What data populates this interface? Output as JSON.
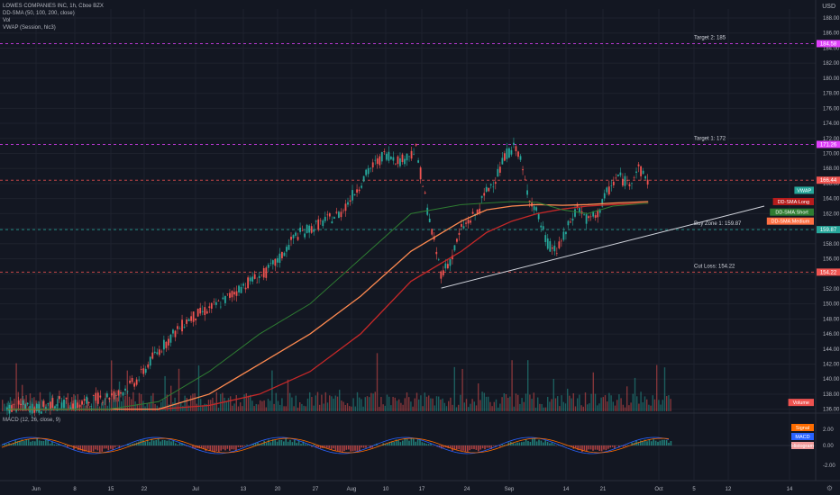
{
  "legend": {
    "title": "LOWES COMPANIES INC, 1h, Cboe BZX",
    "ind1": "DD-SMA (50, 100, 200, close)",
    "ind2": "Vol",
    "ind3": "VWAP (Session, hlc3)"
  },
  "currency": "USD",
  "chart_data": {
    "type": "candlestick",
    "x_ticks": [
      "Jun",
      "8",
      "15",
      "22",
      "Jul",
      "13",
      "20",
      "27",
      "Aug",
      "10",
      "17",
      "24",
      "Sep",
      "14",
      "21",
      "Oct",
      "5",
      "12",
      "14"
    ],
    "y_ticks": [
      136,
      138,
      140,
      142,
      144,
      146,
      148,
      150,
      152,
      154,
      156,
      158,
      160,
      162,
      164,
      166,
      168,
      170,
      172,
      174,
      176,
      178,
      180,
      182,
      184,
      186,
      188
    ],
    "ylim": [
      135.6,
      189.2
    ],
    "levels": [
      {
        "name": "target2",
        "label": "Target 2: 185",
        "price": 184.6,
        "tag": "184.58",
        "color": "#e040fb"
      },
      {
        "name": "target1",
        "label": "Target 1: 172",
        "price": 171.2,
        "tag": "171.26",
        "color": "#e040fb"
      },
      {
        "name": "current",
        "label": "",
        "price": 166.44,
        "tag": "166.44",
        "color": "#ef5350"
      },
      {
        "name": "buyzone",
        "label": "Buy Zone 1: 159.87",
        "price": 159.87,
        "tag": "159.87",
        "color": "#26a69a"
      },
      {
        "name": "cutloss",
        "label": "Cut Loss: 154.22",
        "price": 154.22,
        "tag": "154.22",
        "color": "#ef5350"
      }
    ],
    "side_tags": [
      {
        "label": "VWAP",
        "price": 165.1,
        "color": "#26a69a"
      },
      {
        "label": "DD-SMA:Long",
        "price": 163.6,
        "color": "#b71c1c"
      },
      {
        "label": "DD-SMA:Short",
        "price": 162.2,
        "color": "#2e7d32"
      },
      {
        "label": "DD-SMA:Medium",
        "price": 161.0,
        "color": "#ff7043"
      },
      {
        "label": "Volume",
        "price": 136.9,
        "color": "#ef5350"
      }
    ],
    "price_path": {
      "days": [
        0,
        3,
        6,
        10,
        14,
        18,
        22,
        26,
        29,
        33,
        36,
        39,
        42,
        45,
        48,
        51,
        54,
        57,
        60,
        63,
        66,
        69,
        72,
        75,
        78,
        81,
        84,
        86,
        88,
        90,
        93,
        95,
        97,
        99,
        101,
        103,
        105,
        107,
        109,
        111,
        113,
        115,
        117,
        119,
        121,
        123,
        125,
        127
      ],
      "close": [
        136,
        136.5,
        136,
        137,
        136.5,
        137.5,
        138,
        140,
        143,
        146,
        148,
        149,
        150,
        151.5,
        153,
        154,
        156,
        159,
        160,
        161,
        162,
        165,
        168,
        170,
        169,
        170.5,
        160,
        154,
        156,
        160,
        162,
        165,
        167,
        170,
        171,
        165,
        162,
        158,
        157,
        160,
        163,
        161,
        162,
        165,
        167,
        166,
        168,
        166.4
      ]
    },
    "sma50": {
      "days": [
        0,
        20,
        30,
        40,
        50,
        60,
        70,
        80,
        90,
        95,
        100,
        105,
        110,
        115,
        120,
        127
      ],
      "values": [
        136,
        136,
        137,
        141,
        146,
        150,
        156,
        162,
        163.2,
        163.4,
        163.6,
        163.5,
        162.5,
        162,
        163,
        163.4
      ]
    },
    "sma100": {
      "days": [
        0,
        20,
        30,
        40,
        50,
        60,
        70,
        80,
        90,
        95,
        100,
        105,
        110,
        115,
        120,
        127
      ],
      "values": [
        136,
        136,
        136,
        138,
        142,
        146,
        151,
        157,
        161,
        162.5,
        163,
        163.2,
        163.1,
        163.2,
        163.4,
        163.6
      ]
    },
    "sma200": {
      "days": [
        0,
        20,
        30,
        40,
        50,
        60,
        70,
        80,
        90,
        95,
        100,
        105,
        110,
        115,
        120,
        127
      ],
      "values": [
        136,
        136,
        136,
        136.5,
        138,
        141,
        146,
        153,
        157,
        159.5,
        161,
        162,
        162.6,
        163,
        163.2,
        163.4
      ]
    },
    "trendline": {
      "from": {
        "day": 86,
        "price": 152.1
      },
      "to": {
        "day": 150,
        "price": 163.0
      }
    },
    "macd": {
      "ticks": [
        "2.00",
        "0.00",
        "-2.00"
      ],
      "labels": [
        "Signal",
        "MACD",
        "Histogram"
      ]
    }
  }
}
